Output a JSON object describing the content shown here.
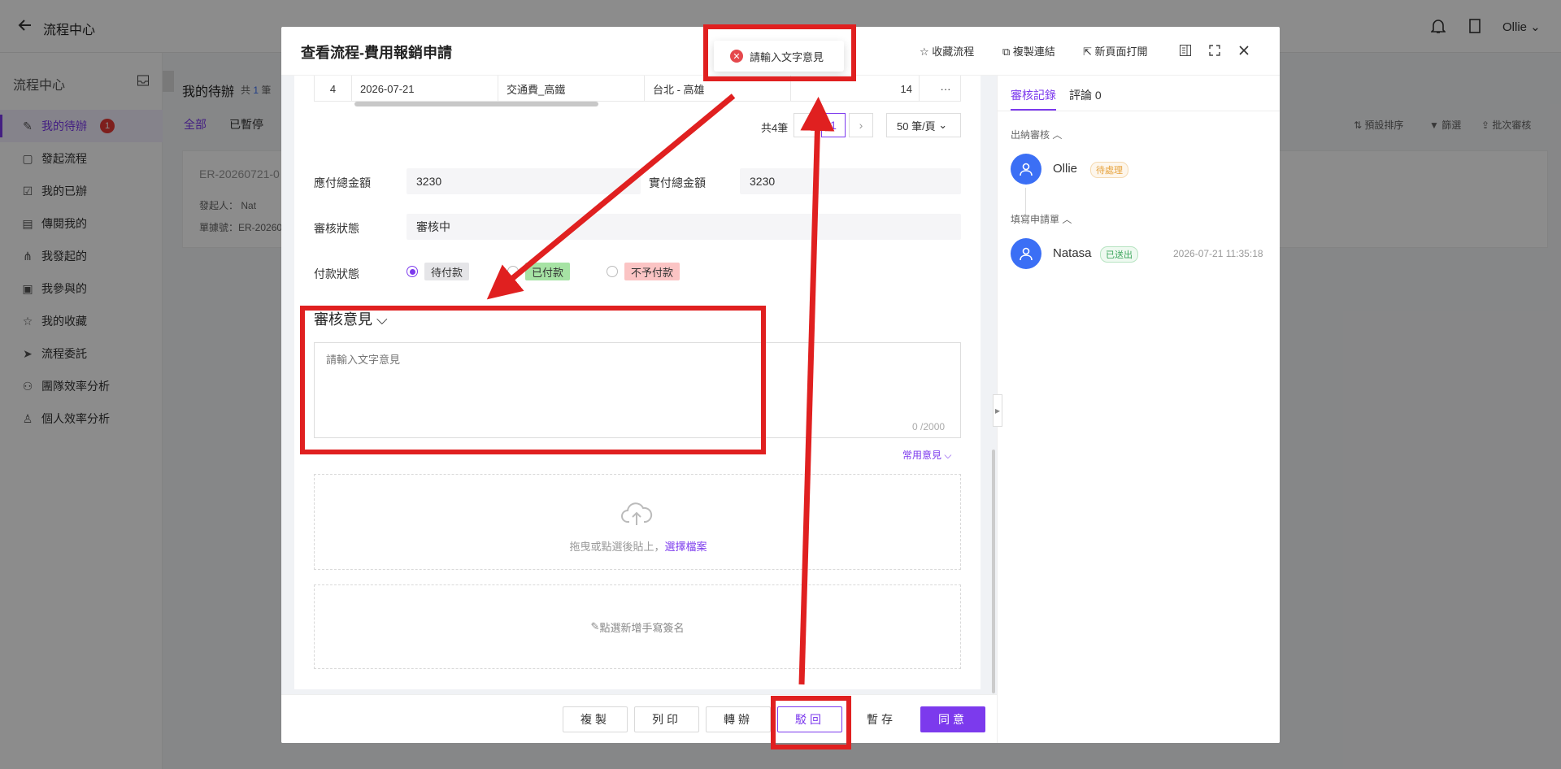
{
  "topbar": {
    "title": "流程中心",
    "user": "Ollie"
  },
  "sidebar": {
    "title": "流程中心",
    "items": [
      {
        "label": "我的待辦",
        "badge": "1"
      },
      {
        "label": "發起流程"
      },
      {
        "label": "我的已辦"
      },
      {
        "label": "傳閱我的"
      },
      {
        "label": "我發起的"
      },
      {
        "label": "我參與的"
      },
      {
        "label": "我的收藏"
      },
      {
        "label": "流程委託"
      },
      {
        "label": "團隊效率分析"
      },
      {
        "label": "個人效率分析"
      }
    ]
  },
  "list": {
    "title": "我的待辦",
    "count_prefix": "共",
    "count": "1",
    "count_suffix": "筆",
    "tabs": [
      "全部",
      "已暫停"
    ],
    "tools": [
      "預設排序",
      "篩選",
      "批次審核"
    ],
    "card": {
      "id": "ER-20260721-0",
      "initiator_label": "發起人：",
      "initiator": "Nat",
      "form_no": "單據號：ER-20260"
    }
  },
  "modal": {
    "title": "查看流程-費用報銷申請",
    "actions": [
      "收藏流程",
      "複製連結",
      "新頁面打開"
    ],
    "toast": "請輸入文字意見",
    "table_row": {
      "no": "4",
      "date": "2026-07-21",
      "type": "交通費_高鐵",
      "route": "台北 - 高雄",
      "amount": "14"
    },
    "pagination": {
      "total": "共4筆",
      "page": "1",
      "size": "50 筆/頁"
    },
    "fields": {
      "payable_label": "應付總金額",
      "payable_value": "3230",
      "paid_label": "實付總金額",
      "paid_value": "3230",
      "status_label": "審核狀態",
      "status_value": "審核中",
      "payment_label": "付款狀態",
      "payment_options": [
        "待付款",
        "已付款",
        "不予付款"
      ]
    },
    "opinion": {
      "title": "審核意見",
      "placeholder": "請輸入文字意見",
      "counter": "0 /2000",
      "common": "常用意見"
    },
    "upload": {
      "text": "拖曳或點選後貼上，",
      "link": "選擇檔案"
    },
    "signature": "點選新增手寫簽名",
    "buttons": [
      "複製",
      "列印",
      "轉辦",
      "駁回",
      "暫存",
      "同意"
    ]
  },
  "panel": {
    "tabs": [
      "審核記錄",
      "評論 0"
    ],
    "sections": [
      {
        "title": "出納審核",
        "name": "Ollie",
        "status": "待處理",
        "time": ""
      },
      {
        "title": "填寫申請單",
        "name": "Natasa",
        "status": "已送出",
        "time": "2026-07-21 11:35:18"
      }
    ]
  },
  "colors": {
    "accent": "#7c3aed",
    "annotation": "#e02020"
  }
}
